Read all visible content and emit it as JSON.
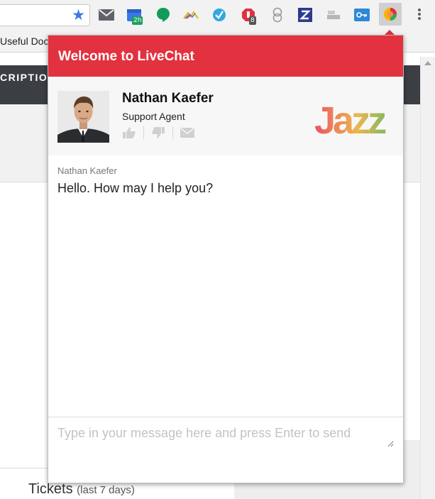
{
  "browser": {
    "bookmark_label": "Useful Doc",
    "badges": {
      "calendar": "2h",
      "adblock": "8"
    }
  },
  "page": {
    "header_text": "CRIPTIO",
    "tickets_title": "Tickets",
    "tickets_sub": "(last 7 days)"
  },
  "livechat": {
    "header_title": "Welcome to LiveChat",
    "agent": {
      "name": "Nathan Kaefer",
      "role": "Support Agent"
    },
    "logo_text": "Jazz",
    "messages": [
      {
        "author": "Nathan Kaefer",
        "text": "Hello. How may I help you?"
      }
    ],
    "composer_placeholder": "Type in your message here and press Enter to send"
  },
  "colors": {
    "accent": "#e2313f",
    "toolbar": "#f2f2f2",
    "page_dark": "#3b3e42"
  }
}
